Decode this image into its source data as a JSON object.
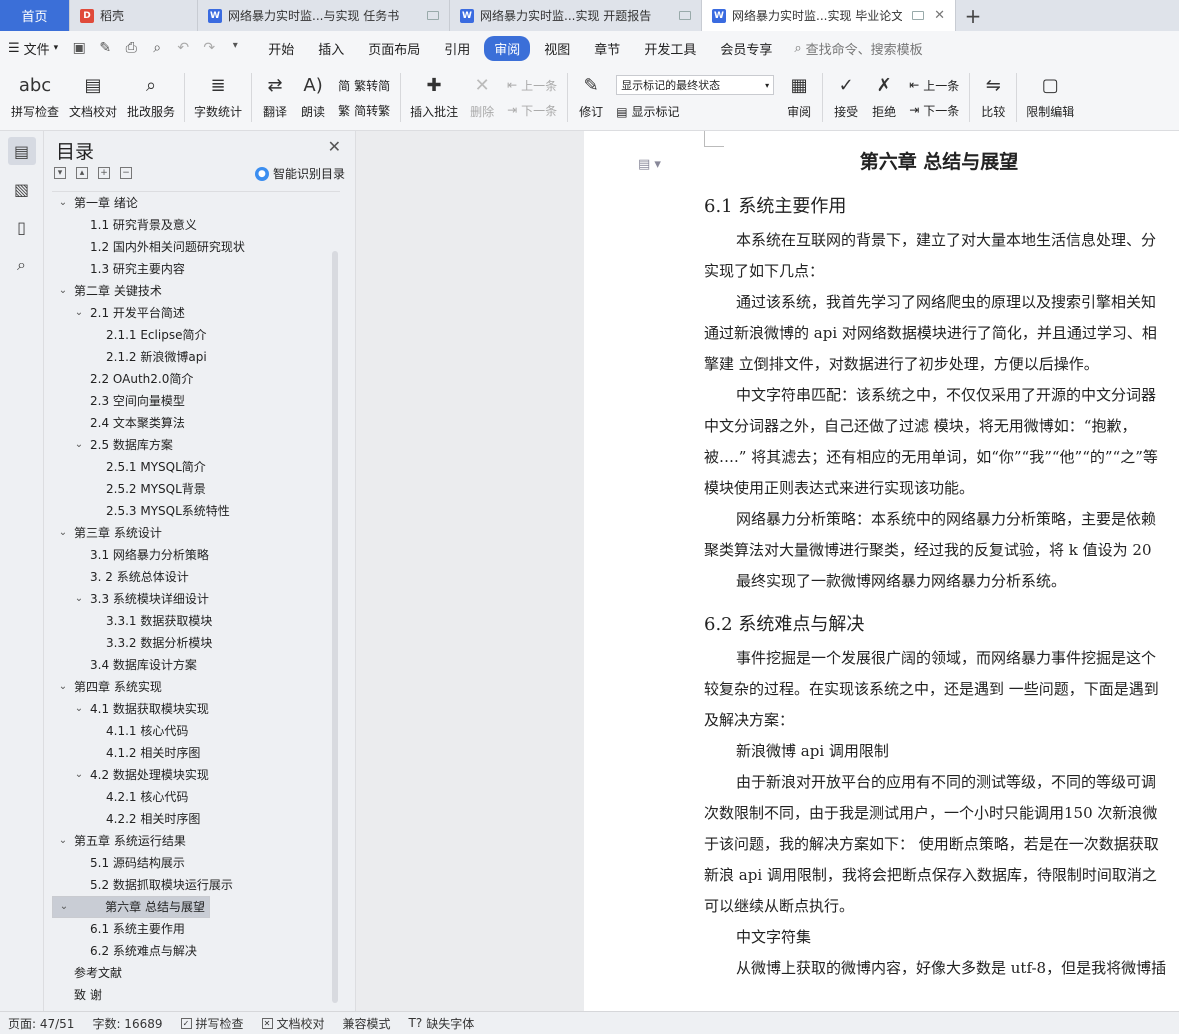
{
  "tabs": [
    {
      "label": "首页"
    },
    {
      "label": "稻壳"
    },
    {
      "label": "网络暴力实时监...与实现 任务书"
    },
    {
      "label": "网络暴力实时监...实现 开题报告"
    },
    {
      "label": "网络暴力实时监...实现 毕业论文"
    }
  ],
  "menu": {
    "file": "文件",
    "tabs": [
      "开始",
      "插入",
      "页面布局",
      "引用",
      "审阅",
      "视图",
      "章节",
      "开发工具",
      "会员专享"
    ],
    "search": "查找命令、搜索模板"
  },
  "ribbon": {
    "spell": "拼写检查",
    "doccheck": "文档校对",
    "batch": "批改服务",
    "wordcount": "字数统计",
    "translate": "翻译",
    "read": "朗读",
    "trad": "繁转简",
    "simp": "简转繁",
    "insert_comment": "插入批注",
    "delete": "删除",
    "prev1": "上一条",
    "next1": "下一条",
    "revise": "修订",
    "markup_select": "显示标记的最终状态",
    "show_markup": "显示标记",
    "review": "审阅",
    "accept": "接受",
    "reject": "拒绝",
    "prev2": "上一条",
    "next2": "下一条",
    "compare": "比较",
    "restrict": "限制编辑"
  },
  "toc": {
    "title": "目录",
    "smart": "智能识别目录",
    "items": [
      "第一章 绪论",
      "1.1 研究背景及意义",
      "1.2 国内外相关问题研究现状",
      "1.3 研究主要内容",
      "第二章 关键技术",
      "2.1 开发平台简述",
      "2.1.1 Eclipse简介",
      "2.1.2 新浪微博api",
      "2.2 OAuth2.0简介",
      "2.3 空间向量模型",
      "2.4 文本聚类算法",
      "2.5 数据库方案",
      "2.5.1 MYSQL简介",
      "2.5.2 MYSQL背景",
      "2.5.3 MYSQL系统特性",
      "第三章 系统设计",
      "3.1 网络暴力分析策略",
      "3. 2 系统总体设计",
      "3.3 系统模块详细设计",
      "3.3.1 数据获取模块",
      "3.3.2 数据分析模块",
      "3.4 数据库设计方案",
      "第四章 系统实现",
      "4.1 数据获取模块实现",
      "4.1.1 核心代码",
      "4.1.2 相关时序图",
      "4.2 数据处理模块实现",
      "4.2.1 核心代码",
      "4.2.2 相关时序图",
      "第五章 系统运行结果",
      "5.1 源码结构展示",
      "5.2 数据抓取模块运行展示",
      "第六章 总结与展望",
      "6.1 系统主要作用",
      "6.2 系统难点与解决",
      "参考文献",
      "致 谢"
    ]
  },
  "document": {
    "chapter_title": "第六章 总结与展望",
    "section1": "6.1 系统主要作用",
    "paragraphs1": [
      "本系统在互联网的背景下，建立了对大量本地生活信息处理、分",
      "实现了如下几点：",
      "通过该系统，我首先学习了网络爬虫的原理以及搜索引擎相关知",
      "通过新浪微博的 api 对网络数据模块进行了简化，并且通过学习、相",
      "擎建 立倒排文件，对数据进行了初步处理，方便以后操作。",
      "中文字符串匹配：该系统之中，不仅仅采用了开源的中文分词器",
      "中文分词器之外，自己还做了过滤 模块，将无用微博如：“抱歉，",
      "被….” 将其滤去；还有相应的无用单词，如“你”“我”“他”“的”“之”等",
      "模块使用正则表达式来进行实现该功能。",
      "网络暴力分析策略：本系统中的网络暴力分析策略，主要是依赖",
      "聚类算法对大量微博进行聚类，经过我的反复试验，将 k 值设为 20 ",
      "最终实现了一款微博网络暴力网络暴力分析系统。"
    ],
    "section2": "6.2 系统难点与解决",
    "paragraphs2": [
      "事件挖掘是一个发展很广阔的领域，而网络暴力事件挖掘是这个",
      "较复杂的过程。在实现该系统之中，还是遇到 一些问题，下面是遇到",
      "及解决方案：",
      "新浪微博 api 调用限制",
      "由于新浪对开放平台的应用有不同的测试等级，不同的等级可调",
      "次数限制不同，由于我是测试用户，一个小时只能调用150 次新浪微",
      "于该问题，我的解决方案如下： 使用断点策略，若是在一次数据获取",
      "新浪 api 调用限制，我将会把断点保存入数据库，待限制时间取消之",
      "可以继续从断点执行。",
      "中文字符集",
      "从微博上获取的微博内容，好像大多数是  utf-8，但是我将微博插"
    ]
  },
  "status": {
    "page": "页面: 47/51",
    "words": "字数: 16689",
    "spell": "拼写检查",
    "doccheck": "文档校对",
    "compat": "兼容模式",
    "missing_font": "缺失字体"
  }
}
